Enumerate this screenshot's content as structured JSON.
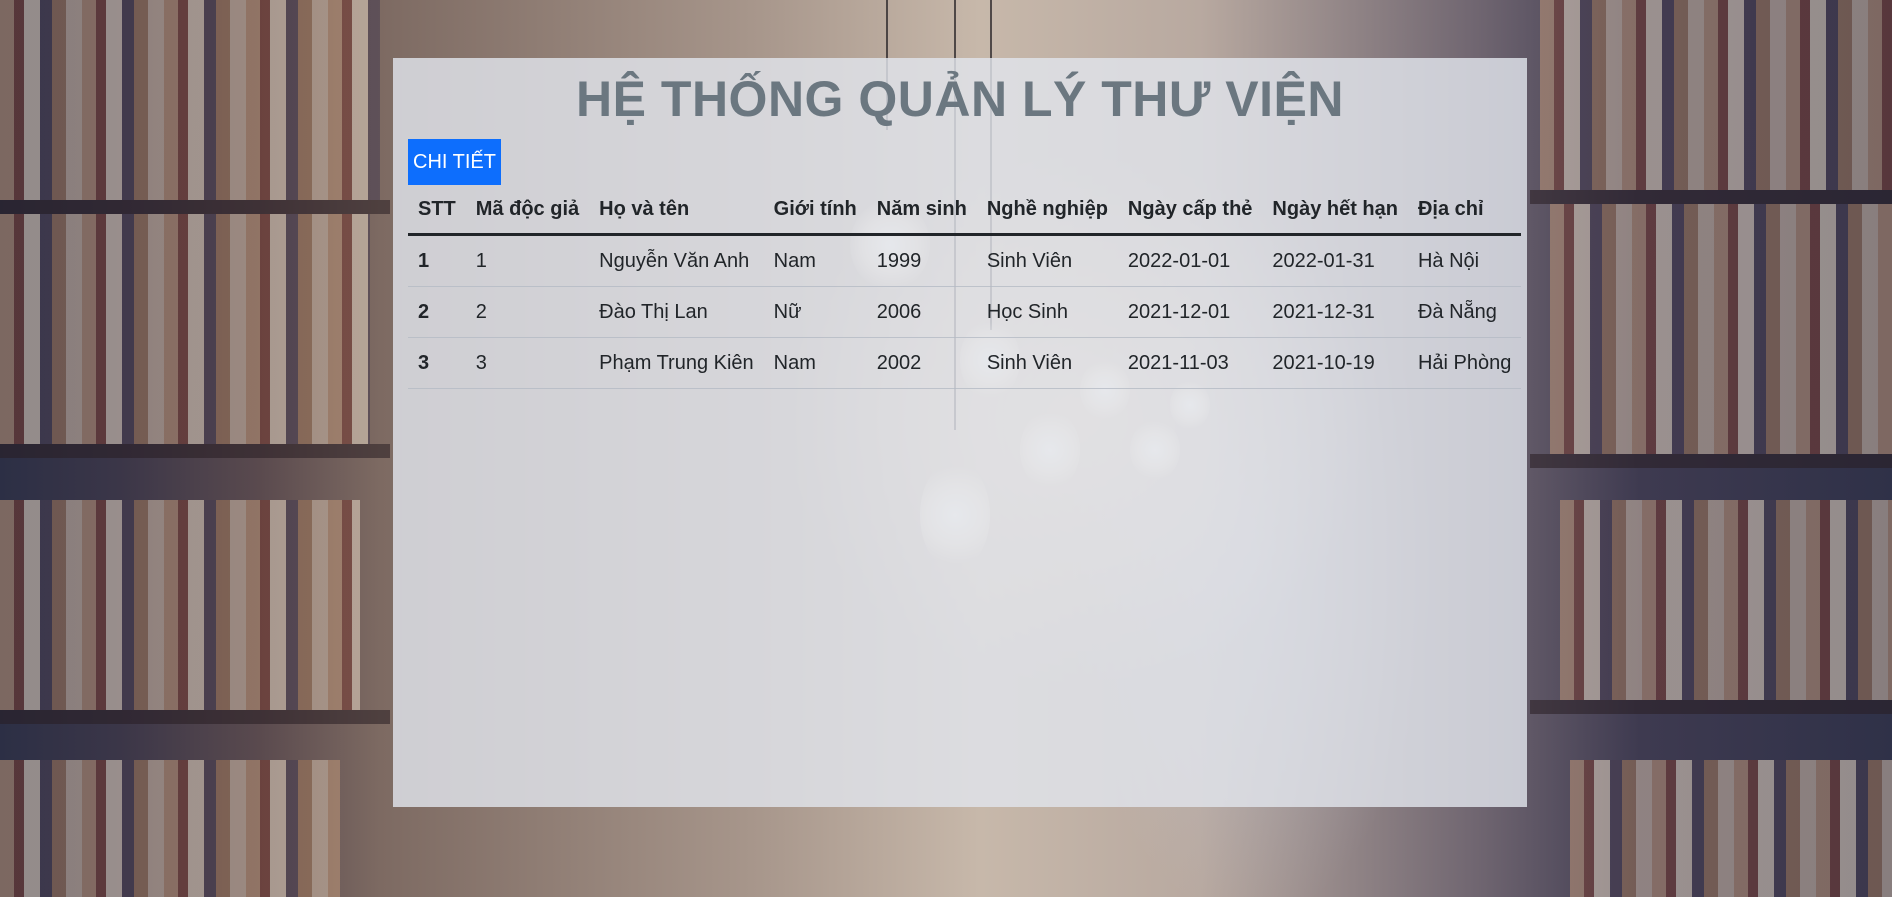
{
  "page": {
    "title": "HỆ THỐNG QUẢN LÝ THƯ VIỆN",
    "detail_button": "CHI TIẾT"
  },
  "table": {
    "headers": [
      "STT",
      "Mã độc giả",
      "Họ và tên",
      "Giới tính",
      "Năm sinh",
      "Nghề nghiệp",
      "Ngày cấp thẻ",
      "Ngày hết hạn",
      "Địa chỉ"
    ],
    "rows": [
      [
        "1",
        "1",
        "Nguyễn Văn Anh",
        "Nam",
        "1999",
        "Sinh Viên",
        "2022-01-01",
        "2022-01-31",
        "Hà Nội"
      ],
      [
        "2",
        "2",
        "Đào Thị Lan",
        "Nữ",
        "2006",
        "Học Sinh",
        "2021-12-01",
        "2021-12-31",
        "Đà Nẵng"
      ],
      [
        "3",
        "3",
        "Phạm Trung Kiên",
        "Nam",
        "2002",
        "Sinh Viên",
        "2021-11-03",
        "2021-10-19",
        "Hải Phòng"
      ]
    ]
  },
  "colors": {
    "button": "#0d6efd",
    "title": "#6b7780",
    "panel": "#e1e4ec"
  }
}
